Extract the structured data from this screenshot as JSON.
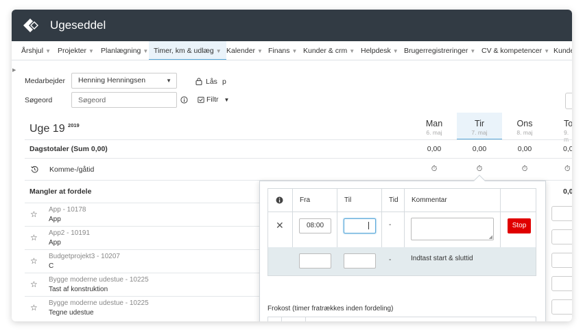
{
  "app": {
    "title": "Ugeseddel",
    "accent": "#5aa9da",
    "titlebar_color": "#323b44"
  },
  "nav": [
    {
      "label": "Årshjul"
    },
    {
      "label": "Projekter"
    },
    {
      "label": "Planlægning"
    },
    {
      "label": "Timer, km & udlæg",
      "active": true
    },
    {
      "label": "Kalender"
    },
    {
      "label": "Finans"
    },
    {
      "label": "Kunder & crm"
    },
    {
      "label": "Helpdesk"
    },
    {
      "label": "Brugerregistreringer"
    },
    {
      "label": "CV & kompetencer"
    },
    {
      "label": "Kunde"
    }
  ],
  "filters": {
    "employee_label": "Medarbejder",
    "employee_value": "Henning Henningsen",
    "lock_label": "Lås",
    "p_label": "p",
    "search_label": "Søgeord",
    "search_placeholder": "Søgeord",
    "filter_label": "Filtr"
  },
  "week": {
    "label": "Uge 19",
    "year": "2019"
  },
  "days": [
    {
      "name": "Man",
      "date": "6. maj"
    },
    {
      "name": "Tir",
      "date": "7. maj",
      "today": true
    },
    {
      "name": "Ons",
      "date": "8. maj"
    },
    {
      "name": "To",
      "date": "9. m"
    }
  ],
  "totals": {
    "label": "Dagstotaler (Sum 0,00)",
    "values": [
      "0,00",
      "0,00",
      "0,00",
      "0,0"
    ]
  },
  "checkin": {
    "label": "Komme-/gåtid"
  },
  "unassigned": {
    "label": "Mangler at fordele",
    "value": "0,0"
  },
  "projects": [
    {
      "name": "App - 10178",
      "task": "App"
    },
    {
      "name": "App2 - 10191",
      "task": "App"
    },
    {
      "name": "Budgetprojekt3 - 10207",
      "task": "C"
    },
    {
      "name": "Bygge moderne udestue - 10225",
      "task": "Tast af konstruktion"
    },
    {
      "name": "Bygge moderne udestue - 10225",
      "task": "Tegne udestue"
    }
  ],
  "popover": {
    "headers": {
      "from": "Fra",
      "to": "Til",
      "time": "Tid",
      "comment": "Kommentar"
    },
    "row1": {
      "from": "08:00",
      "to": "",
      "time": "-",
      "stop": "Stop"
    },
    "row2": {
      "time": "-",
      "hint": "Indtast start & sluttid"
    },
    "lunch": "Frokost (timer fratrækkes inden fordeling)"
  }
}
